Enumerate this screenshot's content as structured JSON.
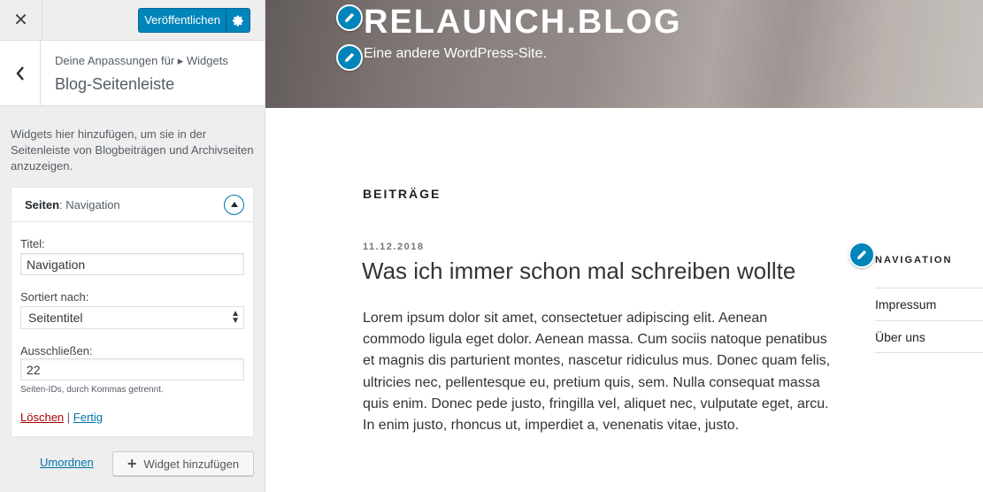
{
  "colors": {
    "accent": "#0085ba",
    "link": "#0073aa",
    "delete": "#a00"
  },
  "toolbar": {
    "close_icon": "close-icon",
    "publish_label": "Veröffentlichen",
    "publish_settings_icon": "gear-icon"
  },
  "section": {
    "breadcrumb": "Deine Anpassungen für ▸ Widgets",
    "title": "Blog-Seitenleiste",
    "description": "Widgets hier hinzufügen, um sie in der Seitenleiste von Blogbeiträgen und Archivseiten anzuzeigen."
  },
  "widget": {
    "name": "Seiten",
    "in_title": ": Navigation",
    "fields": {
      "title_label": "Titel:",
      "title_value": "Navigation",
      "sort_label": "Sortiert nach:",
      "sort_value": "Seitentitel",
      "exclude_label": "Ausschließen:",
      "exclude_value": "22",
      "exclude_help": "Seiten-IDs, durch Kommas getrennt."
    },
    "delete_label": "Löschen",
    "separator": "|",
    "done_label": "Fertig"
  },
  "footer": {
    "reorder_label": "Umordnen",
    "add_widget_label": "Widget hinzufügen"
  },
  "preview": {
    "site_title": "RELAUNCH.BLOG",
    "site_description": "Eine andere WordPress-Site.",
    "posts_heading": "BEITRÄGE",
    "post": {
      "date": "11.12.2018",
      "title": "Was ich immer schon mal schreiben wollte",
      "body": "Lorem ipsum dolor sit amet, consectetuer adipiscing elit. Aenean commodo ligula eget dolor. Aenean massa. Cum sociis natoque penatibus et magnis dis parturient montes, nascetur ridiculus mus. Donec quam felis, ultricies nec, pellentesque eu, pretium quis, sem. Nulla consequat massa quis enim. Donec pede justo, fringilla vel, aliquet nec, vulputate eget, arcu. In enim justo, rhoncus ut, imperdiet a, venenatis vitae, justo."
    },
    "sidebar_widget": {
      "title": "NAVIGATION",
      "items": [
        {
          "label": "Impressum"
        },
        {
          "label": "Über uns"
        }
      ]
    }
  }
}
